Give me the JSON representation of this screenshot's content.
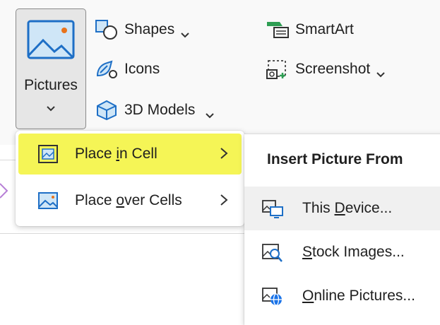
{
  "ribbon": {
    "pictures": {
      "label": "Pictures",
      "icon": "pictures-icon"
    },
    "commands": [
      {
        "id": "shapes",
        "label": "Shapes",
        "icon": "shapes-icon",
        "has_dropdown": true
      },
      {
        "id": "icons",
        "label": "Icons",
        "icon": "icons-icon",
        "has_dropdown": false
      },
      {
        "id": "3d_models",
        "label": "3D Models",
        "icon": "3d-models-icon",
        "has_dropdown": true
      },
      {
        "id": "smartart",
        "label": "SmartArt",
        "icon": "smartart-icon",
        "has_dropdown": false
      },
      {
        "id": "screenshot",
        "label": "Screenshot",
        "icon": "screenshot-icon",
        "has_dropdown": true
      }
    ]
  },
  "menu": {
    "items": [
      {
        "pre": "Place ",
        "key": "i",
        "post": "n Cell",
        "icon": "place-in-cell-icon",
        "highlighted": true
      },
      {
        "pre": "Place ",
        "key": "o",
        "post": "ver Cells",
        "icon": "place-over-cells-icon",
        "highlighted": false
      }
    ]
  },
  "submenu": {
    "header": "Insert Picture From",
    "items": [
      {
        "pre": "This ",
        "key": "D",
        "post": "evice...",
        "icon": "this-device-icon",
        "hovered": true
      },
      {
        "pre": "",
        "key": "S",
        "post": "tock Images...",
        "icon": "stock-images-icon",
        "hovered": false
      },
      {
        "pre": "",
        "key": "O",
        "post": "nline Pictures...",
        "icon": "online-pictures-icon",
        "hovered": false
      }
    ]
  },
  "colors": {
    "accent_blue": "#1e6fc6",
    "icon_light_blue": "#cfe6f7",
    "highlight_yellow": "#f5f556",
    "smartart_green": "#2e9e53",
    "online_blue": "#1a73e8",
    "picture_orange": "#e8731c"
  }
}
